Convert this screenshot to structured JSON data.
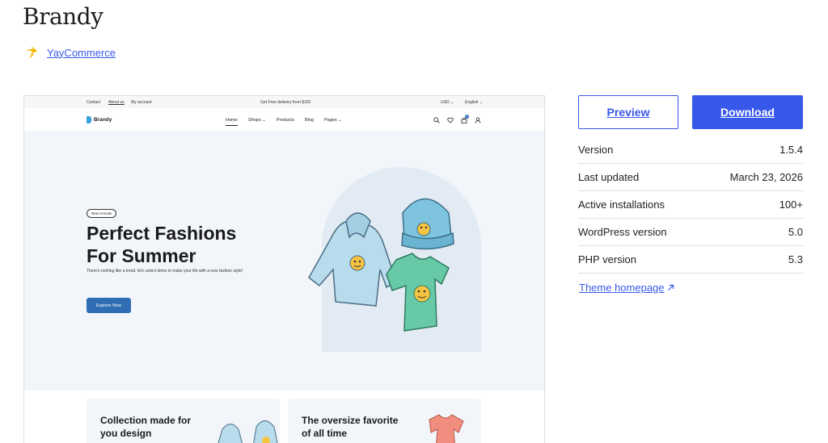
{
  "theme": {
    "title": "Brandy",
    "author": "YayCommerce",
    "author_icon": "yaycommerce-logo-icon"
  },
  "preview": {
    "topbar": {
      "links": [
        "Contact",
        "About us",
        "My account"
      ],
      "promo": "Get Free delivery from $100",
      "currency": "USD ⌄",
      "language": "English ⌄"
    },
    "nav": {
      "logo": "Brandy",
      "items": [
        "Home",
        "Shops ⌄",
        "Products",
        "Blog",
        "Pages ⌄"
      ],
      "icons": [
        "search-icon",
        "heart-icon",
        "cart-icon",
        "user-icon"
      ],
      "cart_count": "0"
    },
    "hero": {
      "badge": "New Arrivals",
      "headline_line1": "Perfect Fashions",
      "headline_line2": "For Summer",
      "sub": "There's nothing like a trend, let's select items to make your life with a new fashion style!",
      "cta": "Explore Now"
    },
    "cards": [
      {
        "line1": "Collection made for",
        "line2": "you design"
      },
      {
        "line1": "The oversize favorite",
        "line2": "of all time"
      }
    ]
  },
  "actions": {
    "preview_label": "Preview",
    "download_label": "Download"
  },
  "meta": [
    {
      "label": "Version",
      "value": "1.5.4"
    },
    {
      "label": "Last updated",
      "value": "March 23, 2026"
    },
    {
      "label": "Active installations",
      "value": "100+"
    },
    {
      "label": "WordPress version",
      "value": "5.0"
    },
    {
      "label": "PHP version",
      "value": "5.3"
    }
  ],
  "homepage_link": "Theme homepage",
  "colors": {
    "accent": "#3858e9",
    "preview_cta": "#2f6db4",
    "hero_bg": "#f2f6fa"
  }
}
